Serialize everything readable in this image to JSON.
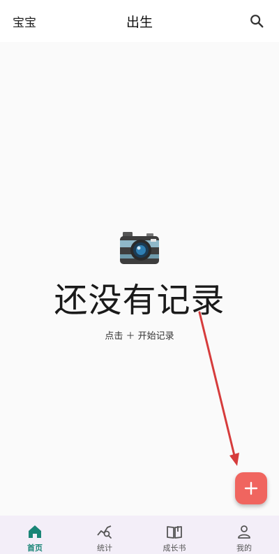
{
  "header": {
    "left_label": "宝宝",
    "title": "出生",
    "search_icon": "search-icon"
  },
  "empty_state": {
    "icon": "camera-icon",
    "title": "还没有记录",
    "hint": "点击 ＋ 开始记录"
  },
  "fab": {
    "icon": "plus-icon",
    "color": "#f0655f"
  },
  "bottom_nav": {
    "items": [
      {
        "label": "首页",
        "icon": "home-icon",
        "active": true
      },
      {
        "label": "统计",
        "icon": "stats-icon",
        "active": false
      },
      {
        "label": "成长书",
        "icon": "book-icon",
        "active": false
      },
      {
        "label": "我的",
        "icon": "profile-icon",
        "active": false
      }
    ],
    "active_color": "#1a8577",
    "background": "#f3eef8"
  },
  "annotation": {
    "arrow_color": "#d63c3c"
  }
}
